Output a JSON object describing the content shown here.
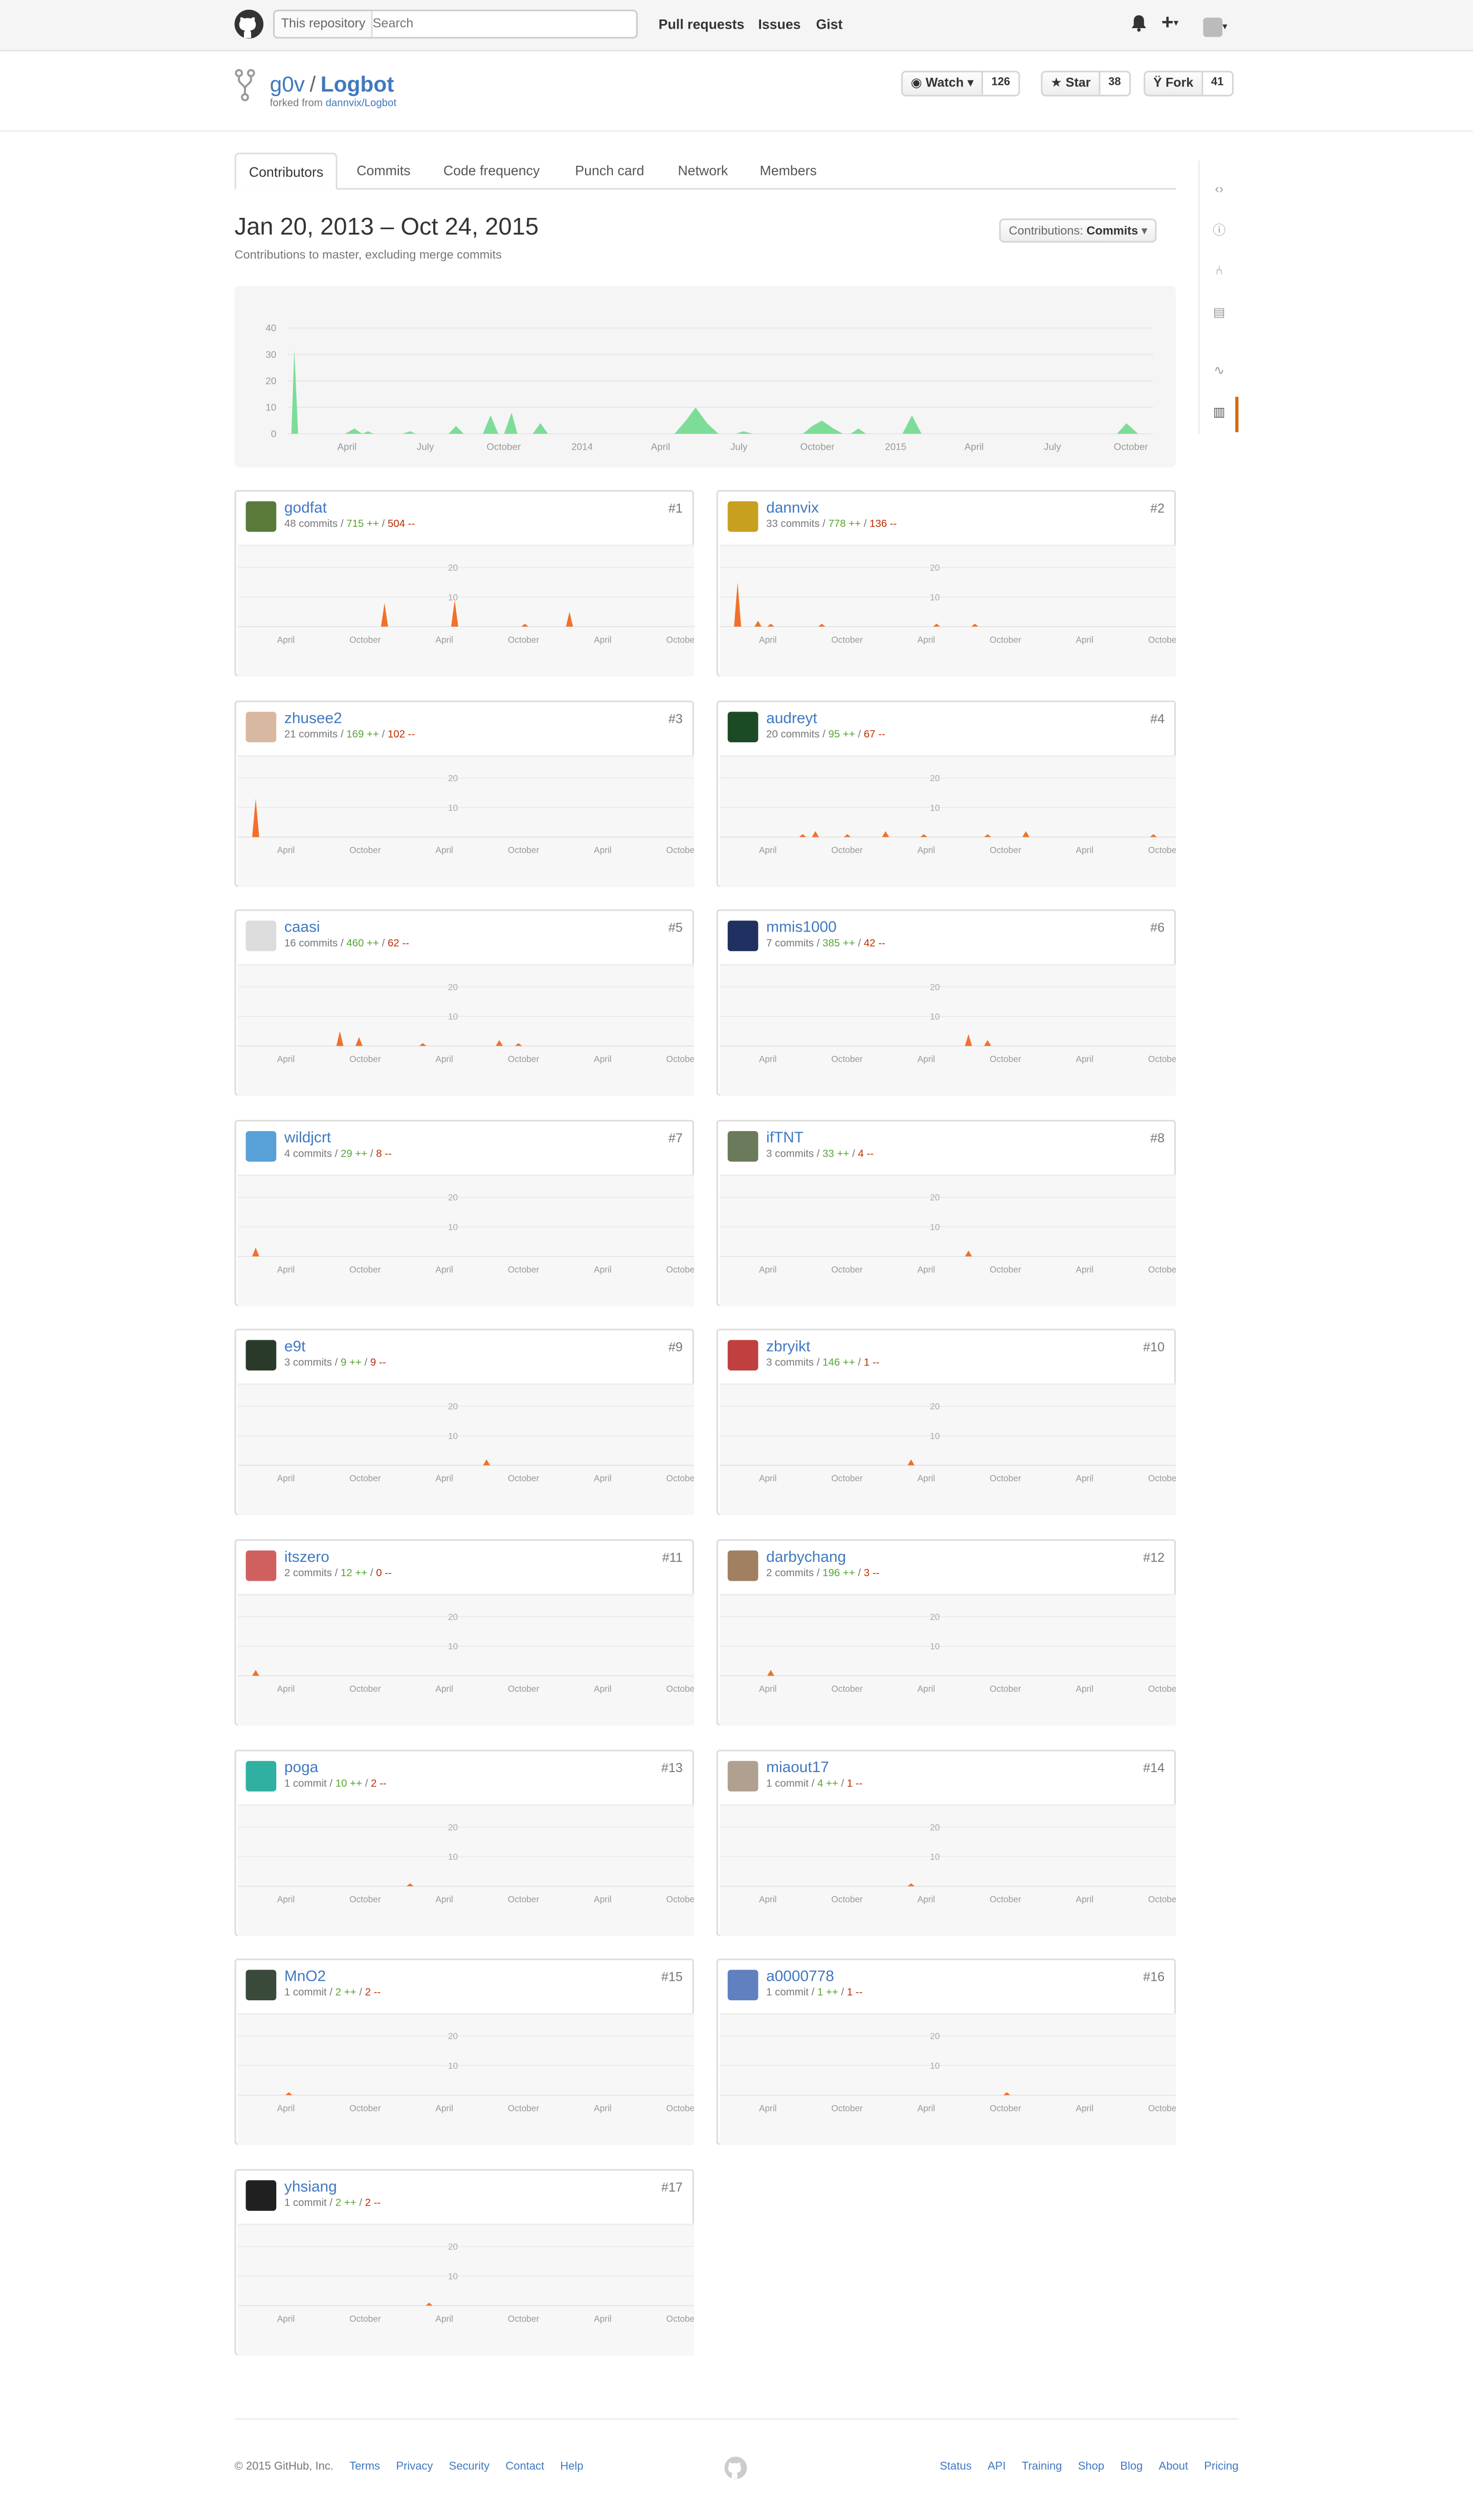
{
  "header": {
    "search_scope": "This repository",
    "search_placeholder": "Search",
    "nav": [
      "Pull requests",
      "Issues",
      "Gist"
    ]
  },
  "repo": {
    "owner": "g0v",
    "name": "Logbot",
    "forked_prefix": "forked from",
    "forked_from": "dannvix/Logbot",
    "watch_label": "Watch",
    "watch_count": "126",
    "star_label": "Star",
    "star_count": "38",
    "fork_label": "Fork",
    "fork_count": "41"
  },
  "tabs": [
    "Contributors",
    "Commits",
    "Code frequency",
    "Punch card",
    "Network",
    "Members"
  ],
  "page": {
    "date_range": "Jan 20, 2013 – Oct 24, 2015",
    "subtitle": "Contributions to master, excluding merge commits",
    "contrib_prefix": "Contributions:",
    "contrib_value": "Commits"
  },
  "colors": {
    "overview_fill": "#7ddc97",
    "contributor_fill": "#f1712a",
    "link": "#4078c0",
    "additions": "#55a532",
    "deletions": "#bd2c00"
  },
  "chart_data": [
    {
      "type": "area",
      "x_tick_labels": [
        "April",
        "July",
        "October",
        "2014",
        "April",
        "July",
        "October",
        "2015",
        "April",
        "July",
        "October"
      ],
      "yticks": [
        0,
        10,
        20,
        30,
        40
      ],
      "ylim": [
        0,
        45
      ],
      "series": [
        {
          "points": [
            [
              0,
              0
            ],
            [
              0.2,
              0
            ],
            [
              0.35,
              32
            ],
            [
              0.55,
              0
            ],
            [
              3,
              0
            ],
            [
              3.5,
              2
            ],
            [
              3.9,
              0
            ],
            [
              4.2,
              1
            ],
            [
              4.5,
              0
            ],
            [
              6,
              0
            ],
            [
              6.4,
              1
            ],
            [
              6.7,
              0
            ],
            [
              8.4,
              0
            ],
            [
              8.8,
              3
            ],
            [
              9.2,
              0
            ],
            [
              10.2,
              0
            ],
            [
              10.6,
              7
            ],
            [
              11,
              0
            ],
            [
              11.3,
              0
            ],
            [
              11.7,
              8
            ],
            [
              12,
              0
            ],
            [
              12.8,
              0
            ],
            [
              13.2,
              4
            ],
            [
              13.6,
              0
            ],
            [
              20.2,
              0
            ],
            [
              20.8,
              5
            ],
            [
              21.3,
              10
            ],
            [
              21.9,
              4
            ],
            [
              22.5,
              0
            ],
            [
              23.4,
              0
            ],
            [
              23.8,
              1
            ],
            [
              24.3,
              0
            ],
            [
              26.9,
              0
            ],
            [
              27.4,
              3
            ],
            [
              27.9,
              5
            ],
            [
              28.5,
              2
            ],
            [
              29,
              0
            ],
            [
              29.4,
              0
            ],
            [
              29.8,
              2
            ],
            [
              30.2,
              0
            ],
            [
              32.1,
              0
            ],
            [
              32.6,
              7
            ],
            [
              33.1,
              0
            ],
            [
              43.3,
              0
            ],
            [
              43.8,
              4
            ],
            [
              44.4,
              0
            ],
            [
              45.2,
              0
            ]
          ]
        }
      ]
    }
  ],
  "mini_chart": {
    "x_tick_labels": [
      "April",
      "October",
      "April",
      "October",
      "April",
      "October"
    ],
    "yticks": [
      10,
      20
    ],
    "ylim": [
      0,
      25
    ]
  },
  "contributors": [
    {
      "rank": "#1",
      "name": "godfat",
      "commits": "48 commits",
      "additions": "715 ++",
      "deletions": "504 --",
      "avatar": "#5a7a3a",
      "peaks": [
        [
          10.5,
          8
        ],
        [
          16,
          9
        ],
        [
          21.5,
          1
        ],
        [
          25,
          5
        ],
        [
          35,
          3
        ]
      ]
    },
    {
      "rank": "#2",
      "name": "dannvix",
      "commits": "33 commits",
      "additions": "778 ++",
      "deletions": "136 --",
      "avatar": "#c8a020",
      "peaks": [
        [
          0.4,
          15
        ],
        [
          2,
          2
        ],
        [
          3,
          1
        ],
        [
          7,
          1
        ],
        [
          16,
          1
        ],
        [
          19,
          1
        ]
      ]
    },
    {
      "rank": "#3",
      "name": "zhusee2",
      "commits": "21 commits",
      "additions": "169 ++",
      "deletions": "102 --",
      "avatar": "#d8b8a0",
      "peaks": [
        [
          0.4,
          13
        ]
      ]
    },
    {
      "rank": "#4",
      "name": "audreyt",
      "commits": "20 commits",
      "additions": "95 ++",
      "deletions": "67 --",
      "avatar": "#1c4a24",
      "peaks": [
        [
          5.5,
          1
        ],
        [
          6.5,
          2
        ],
        [
          9,
          1
        ],
        [
          12,
          2
        ],
        [
          15,
          1
        ],
        [
          20,
          1
        ],
        [
          23,
          2
        ],
        [
          33,
          1
        ]
      ]
    },
    {
      "rank": "#5",
      "name": "caasi",
      "commits": "16 commits",
      "additions": "460 ++",
      "deletions": "62 --",
      "avatar": "#dcdcdc",
      "peaks": [
        [
          7,
          5
        ],
        [
          8.5,
          3
        ],
        [
          13.5,
          1
        ],
        [
          19.5,
          2
        ],
        [
          21,
          1
        ]
      ]
    },
    {
      "rank": "#6",
      "name": "mmis1000",
      "commits": "7 commits",
      "additions": "385 ++",
      "deletions": "42 --",
      "avatar": "#203060",
      "peaks": [
        [
          18.5,
          4
        ],
        [
          20,
          2
        ]
      ]
    },
    {
      "rank": "#7",
      "name": "wildjcrt",
      "commits": "4 commits",
      "additions": "29 ++",
      "deletions": "8 --",
      "avatar": "#58a0d8",
      "peaks": [
        [
          0.4,
          3
        ]
      ]
    },
    {
      "rank": "#8",
      "name": "ifTNT",
      "commits": "3 commits",
      "additions": "33 ++",
      "deletions": "4 --",
      "avatar": "#6a7a5a",
      "peaks": [
        [
          18.5,
          2
        ]
      ]
    },
    {
      "rank": "#9",
      "name": "e9t",
      "commits": "3 commits",
      "additions": "9 ++",
      "deletions": "9 --",
      "avatar": "#2a3a2a",
      "peaks": [
        [
          18.5,
          2
        ]
      ]
    },
    {
      "rank": "#10",
      "name": "zbryikt",
      "commits": "3 commits",
      "additions": "146 ++",
      "deletions": "1 --",
      "avatar": "#c04040",
      "peaks": [
        [
          14,
          2
        ]
      ]
    },
    {
      "rank": "#11",
      "name": "itszero",
      "commits": "2 commits",
      "additions": "12 ++",
      "deletions": "0 --",
      "avatar": "#d06060",
      "peaks": [
        [
          0.4,
          2
        ]
      ]
    },
    {
      "rank": "#12",
      "name": "darbychang",
      "commits": "2 commits",
      "additions": "196 ++",
      "deletions": "3 --",
      "avatar": "#a08060",
      "peaks": [
        [
          3,
          2
        ]
      ]
    },
    {
      "rank": "#13",
      "name": "poga",
      "commits": "1 commit",
      "additions": "10 ++",
      "deletions": "2 --",
      "avatar": "#30b0a0",
      "peaks": [
        [
          12.5,
          1
        ]
      ]
    },
    {
      "rank": "#14",
      "name": "miaout17",
      "commits": "1 commit",
      "additions": "4 ++",
      "deletions": "1 --",
      "avatar": "#b0a090",
      "peaks": [
        [
          14,
          1
        ]
      ]
    },
    {
      "rank": "#15",
      "name": "MnO2",
      "commits": "1 commit",
      "additions": "2 ++",
      "deletions": "2 --",
      "avatar": "#3a4a3a",
      "peaks": [
        [
          3,
          1
        ]
      ]
    },
    {
      "rank": "#16",
      "name": "a0000778",
      "commits": "1 commit",
      "additions": "1 ++",
      "deletions": "1 --",
      "avatar": "#6080c0",
      "peaks": [
        [
          21.5,
          1
        ]
      ]
    },
    {
      "rank": "#17",
      "name": "yhsiang",
      "commits": "1 commit",
      "additions": "2 ++",
      "deletions": "2 --",
      "avatar": "#202020",
      "peaks": [
        [
          14,
          1
        ]
      ]
    }
  ],
  "footer": {
    "copyright": "© 2015 GitHub, Inc.",
    "left_links": [
      "Terms",
      "Privacy",
      "Security",
      "Contact",
      "Help"
    ],
    "right_links": [
      "Status",
      "API",
      "Training",
      "Shop",
      "Blog",
      "About",
      "Pricing"
    ]
  }
}
